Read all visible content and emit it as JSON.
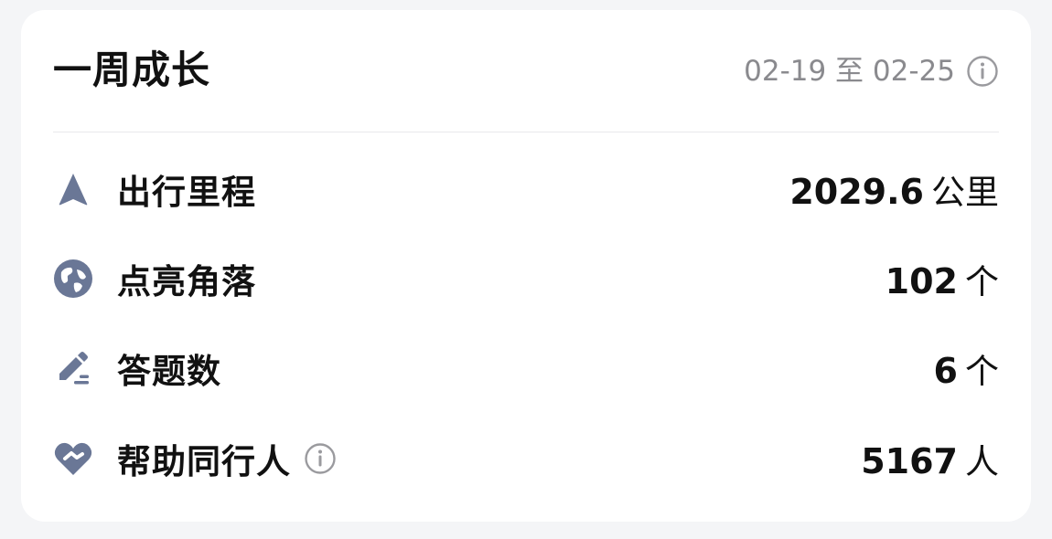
{
  "card": {
    "title": "一周成长",
    "date_range": "02-19 至 02-25"
  },
  "stats": [
    {
      "icon": "navigation-arrow-icon",
      "label": "出行里程",
      "value": "2029.6",
      "unit": "公里"
    },
    {
      "icon": "globe-icon",
      "label": "点亮角落",
      "value": "102",
      "unit": "个"
    },
    {
      "icon": "pen-edit-icon",
      "label": "答题数",
      "value": "6",
      "unit": "个"
    },
    {
      "icon": "handshake-heart-icon",
      "label": "帮助同行人",
      "value": "5167",
      "unit": "人",
      "has_info": true
    }
  ],
  "colors": {
    "icon": "#6a7796",
    "text": "#111111",
    "muted": "#8a8a8e",
    "divider": "#e9e9eb"
  }
}
